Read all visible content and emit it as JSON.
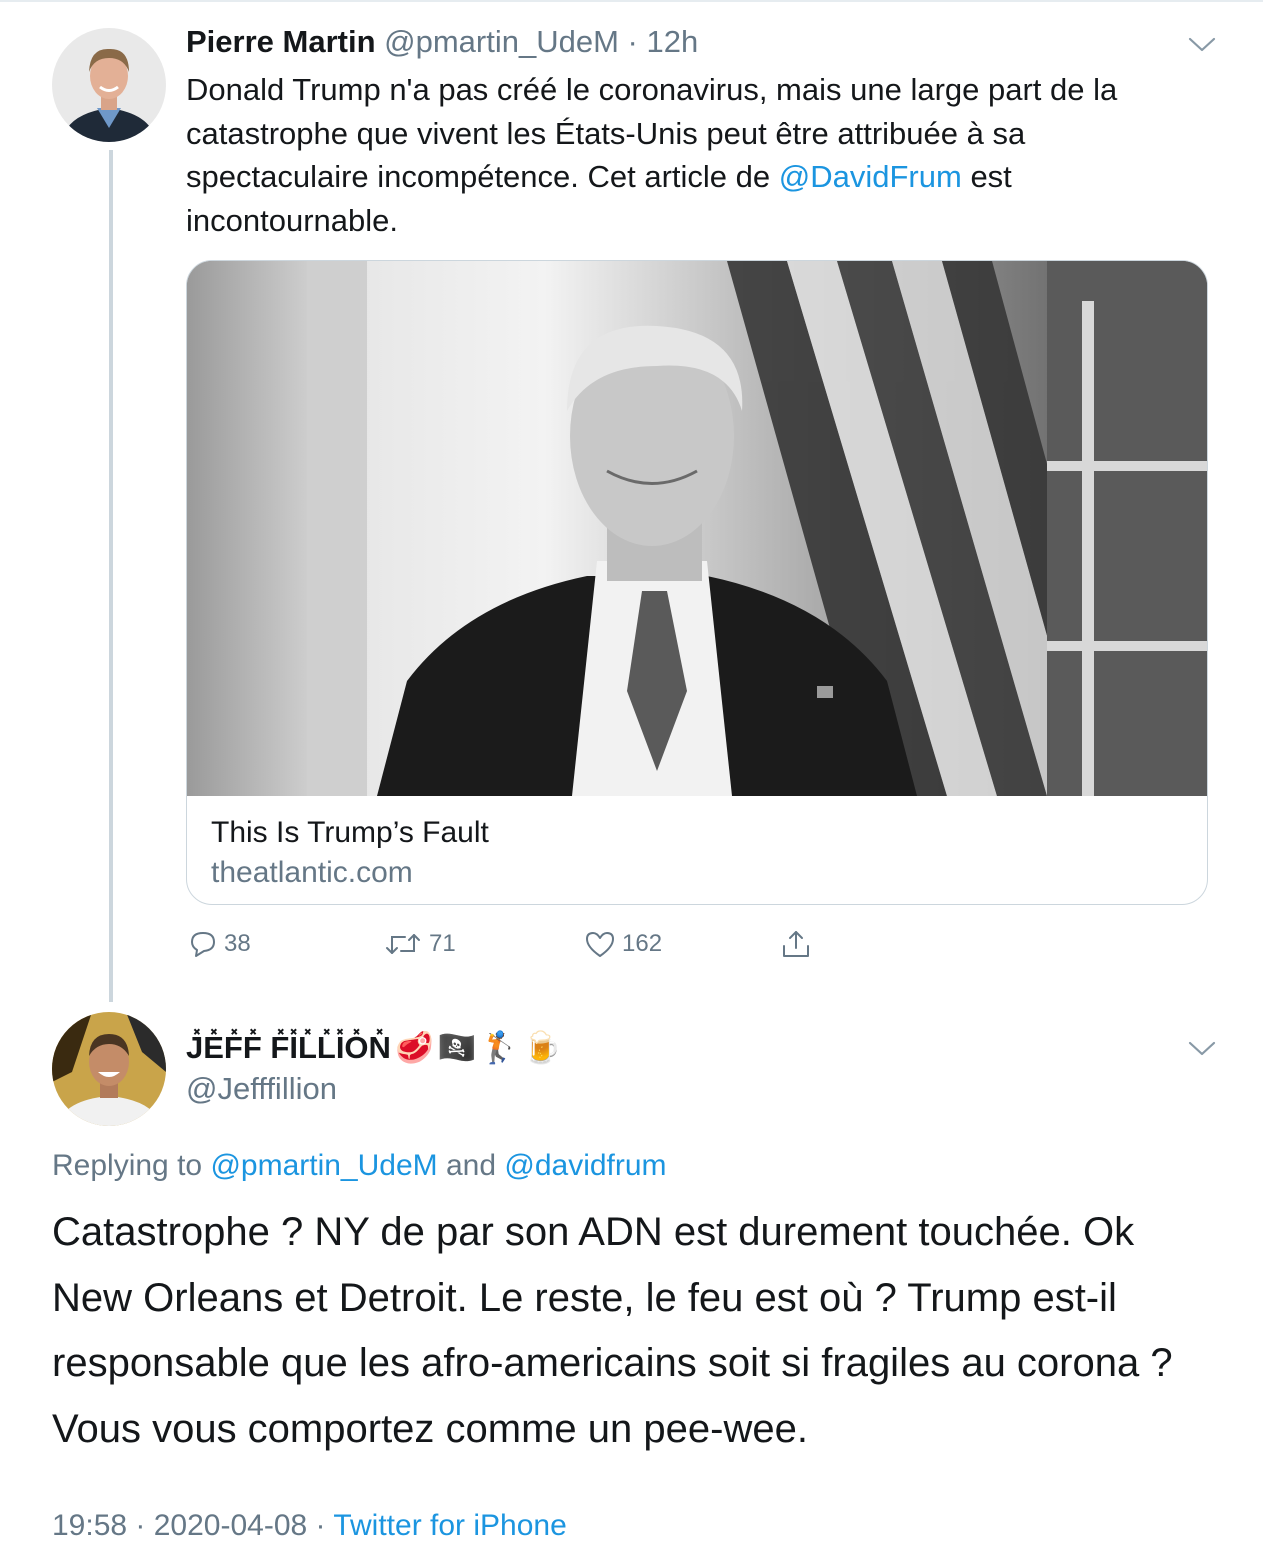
{
  "tweet1": {
    "author_name": "Pierre Martin",
    "author_handle": "@pmartin_UdeM",
    "dot": " · ",
    "time": "12h",
    "text_before_mention": "Donald Trump n'a pas créé le coronavirus, mais une large part de la catastrophe que vivent les États-Unis peut être attribuée à sa spectaculaire incompétence. Cet article de ",
    "mention": "@DavidFrum",
    "text_after_mention": " est incontournable.",
    "card": {
      "title": "This Is Trump’s Fault",
      "domain": "theatlantic.com"
    },
    "actions": {
      "replies": "38",
      "retweets": "71",
      "likes": "162"
    }
  },
  "tweet2": {
    "author_name": "J̽E̽F̽F̽ F̽I̽L̽L̽I̽O̽N̽",
    "name_emojis": [
      "🥩",
      "🏴‍☠️",
      "🏌️",
      "🍺"
    ],
    "author_handle": "@Jefffillion",
    "replying_label": "Replying to ",
    "reply_to_1": "@pmartin_UdeM",
    "reply_and": " and ",
    "reply_to_2": "@davidfrum",
    "text": "Catastrophe ? NY de par son ADN est durement touchée. Ok New Orleans et Detroit. Le reste, le feu est où ? Trump est-il responsable que les afro-americains soit si fragiles au corona ? Vous vous comportez comme un pee-wee.",
    "time": "19:58",
    "sep1": " · ",
    "date": "2020-04-08",
    "sep2": " · ",
    "source": "Twitter for iPhone"
  },
  "colors": {
    "link": "#1b95e0",
    "muted": "#657786",
    "text": "#14171a",
    "border": "#ccd6dd"
  },
  "icons": [
    "chevron-down-icon",
    "reply-icon",
    "retweet-icon",
    "like-icon",
    "share-icon"
  ]
}
